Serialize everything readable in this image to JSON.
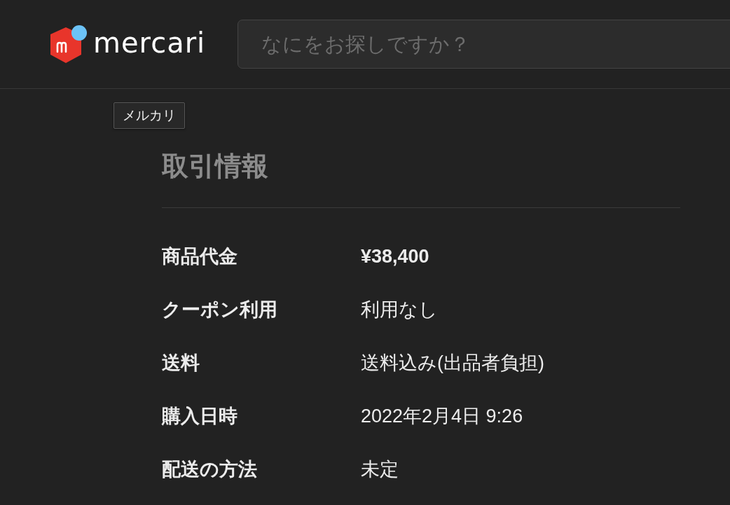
{
  "header": {
    "logo": {
      "text": "mercari"
    },
    "search": {
      "placeholder": "なにをお探しですか？"
    }
  },
  "tooltip": {
    "text": "メルカリ"
  },
  "transaction": {
    "title": "取引情報",
    "rows": [
      {
        "label": "商品代金",
        "value": "¥38,400",
        "kind": "price"
      },
      {
        "label": "クーポン利用",
        "value": "利用なし",
        "kind": "text"
      },
      {
        "label": "送料",
        "value": "送料込み(出品者負担)",
        "kind": "text"
      },
      {
        "label": "購入日時",
        "value": "2022年2月4日 9:26",
        "kind": "text"
      },
      {
        "label": "配送の方法",
        "value": "未定",
        "kind": "text"
      }
    ]
  }
}
